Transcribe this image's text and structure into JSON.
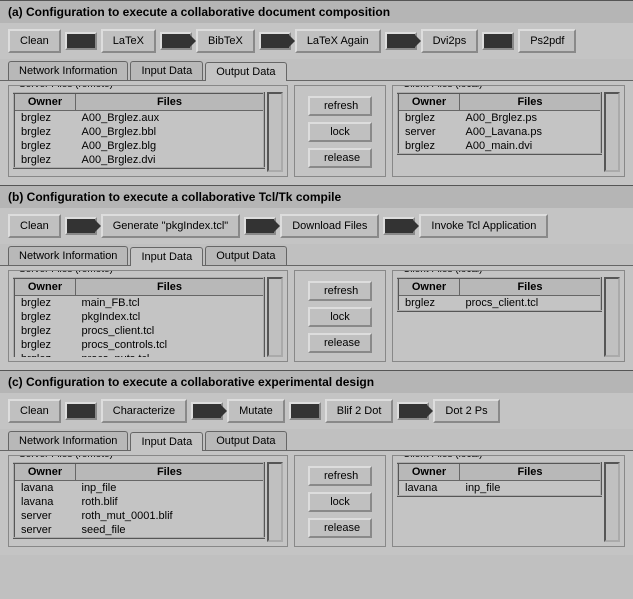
{
  "sections": [
    {
      "title": "(a)  Configuration to execute a collaborative document composition",
      "toolbar": [
        "Clean",
        {
          "arrow": "flat"
        },
        "LaTeX",
        {
          "arrow": "point"
        },
        "BibTeX",
        {
          "arrow": "point"
        },
        "LaTeX Again",
        {
          "arrow": "point"
        },
        "Dvi2ps",
        {
          "arrow": "flat"
        },
        "Ps2pdf"
      ],
      "active_tab": "Output Data",
      "server_rows": [
        [
          "brglez",
          "A00_Brglez.aux"
        ],
        [
          "brglez",
          "A00_Brglez.bbl"
        ],
        [
          "brglez",
          "A00_Brglez.blg"
        ],
        [
          "brglez",
          "A00_Brglez.dvi"
        ]
      ],
      "client_rows": [
        [
          "brglez",
          "A00_Brglez.ps"
        ],
        [
          "server",
          "A00_Lavana.ps"
        ],
        [
          "brglez",
          "A00_main.dvi"
        ]
      ]
    },
    {
      "title": "(b)  Configuration to execute a collaborative Tcl/Tk compile",
      "toolbar": [
        "Clean",
        {
          "arrow": "point"
        },
        "Generate \"pkgIndex.tcl\"",
        {
          "arrow": "point"
        },
        "Download Files",
        {
          "arrow": "point"
        },
        "Invoke Tcl Application"
      ],
      "active_tab": "Input Data",
      "server_rows": [
        [
          "brglez",
          "main_FB.tcl"
        ],
        [
          "brglez",
          "pkgIndex.tcl"
        ],
        [
          "brglez",
          "procs_client.tcl"
        ],
        [
          "brglez",
          "procs_controls.tcl"
        ],
        [
          "brglez",
          "procs_nuts.tcl"
        ]
      ],
      "client_rows": [
        [
          "brglez",
          "procs_client.tcl"
        ]
      ]
    },
    {
      "title": "(c)  Configuration to execute a collaborative experimental design",
      "toolbar": [
        "Clean",
        {
          "arrow": "flat"
        },
        "Characterize",
        {
          "arrow": "point"
        },
        "Mutate",
        {
          "arrow": "flat"
        },
        "Blif 2 Dot",
        {
          "arrow": "point"
        },
        "Dot 2 Ps"
      ],
      "active_tab": "Input Data",
      "server_rows": [
        [
          "lavana",
          "inp_file"
        ],
        [
          "lavana",
          "roth.blif"
        ],
        [
          "server",
          "roth_mut_0001.blif"
        ],
        [
          "server",
          "seed_file"
        ]
      ],
      "client_rows": [
        [
          "lavana",
          "inp_file"
        ]
      ]
    }
  ],
  "labels": {
    "tabs": [
      "Network Information",
      "Input Data",
      "Output Data"
    ],
    "server_legend": "Server Files (remote)",
    "client_legend": "Client Files (local)",
    "owner": "Owner",
    "files": "Files",
    "refresh": "refresh",
    "lock": "lock",
    "release": "release"
  }
}
